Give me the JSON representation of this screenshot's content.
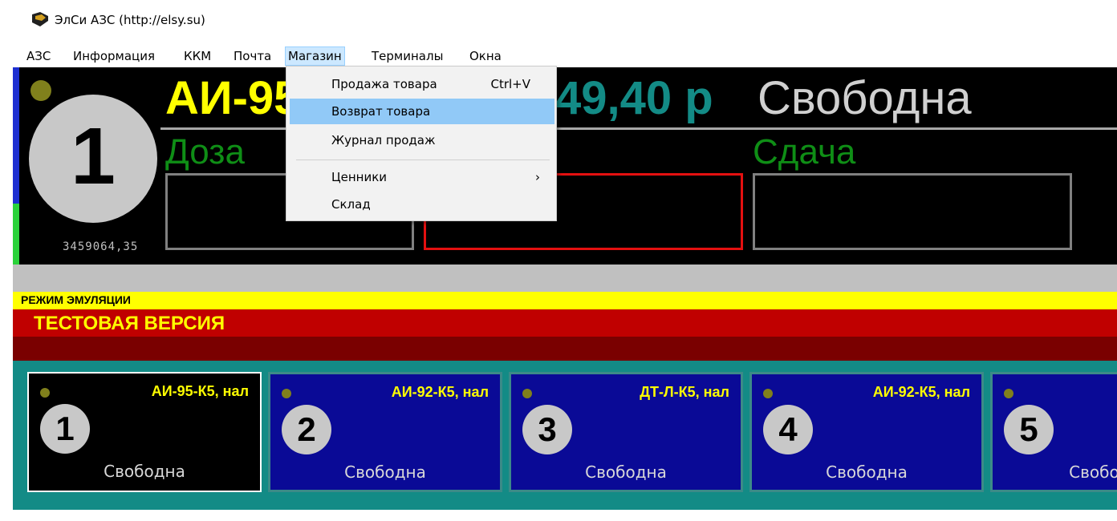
{
  "window": {
    "title": "ЭлСи АЗС  (http://elsy.su)",
    "icon": "app-logo-icon"
  },
  "menu": {
    "items": [
      "АЗС",
      "Информация",
      "ККМ",
      "Почта",
      "Магазин",
      "Терминалы",
      "Окна"
    ],
    "active": "Магазин",
    "dropdown": {
      "items": [
        {
          "label": "Продажа товара",
          "shortcut": "Ctrl+V"
        },
        {
          "label": "Возврат товара",
          "highlighted": true
        },
        {
          "label": "Журнал продаж"
        },
        {
          "label": "Ценники",
          "submenu_arrow": "›"
        },
        {
          "label": "Склад"
        }
      ]
    }
  },
  "pump_display": {
    "number": "1",
    "counter": "3459064,35",
    "fuel": "АИ-95",
    "price": "49,40 р",
    "status": "Свободна",
    "dose_label": "Доза",
    "change_label": "Сдача"
  },
  "banners": {
    "emulation": "РЕЖИМ ЭМУЛЯЦИИ",
    "test_version": "ТЕСТОВАЯ ВЕРСИЯ"
  },
  "pumps": [
    {
      "number": "1",
      "fuel": "АИ-95-К5, нал",
      "status": "Свободна",
      "selected": true
    },
    {
      "number": "2",
      "fuel": "АИ-92-К5, нал",
      "status": "Свободна"
    },
    {
      "number": "3",
      "fuel": "ДТ-Л-К5, нал",
      "status": "Свободна"
    },
    {
      "number": "4",
      "fuel": "АИ-92-К5, нал",
      "status": "Свободна"
    },
    {
      "number": "5",
      "fuel": "",
      "status": "Свободна"
    }
  ],
  "colors": {
    "menu_active": "#cce8ff",
    "dropdown_highlight": "#91c9f7",
    "fuel_yellow": "#ffff00",
    "price_teal": "#138b86",
    "label_green": "#0f8e16",
    "card_blue": "#0a0a96",
    "card_selected": "#000000",
    "test_red": "#c00000"
  }
}
